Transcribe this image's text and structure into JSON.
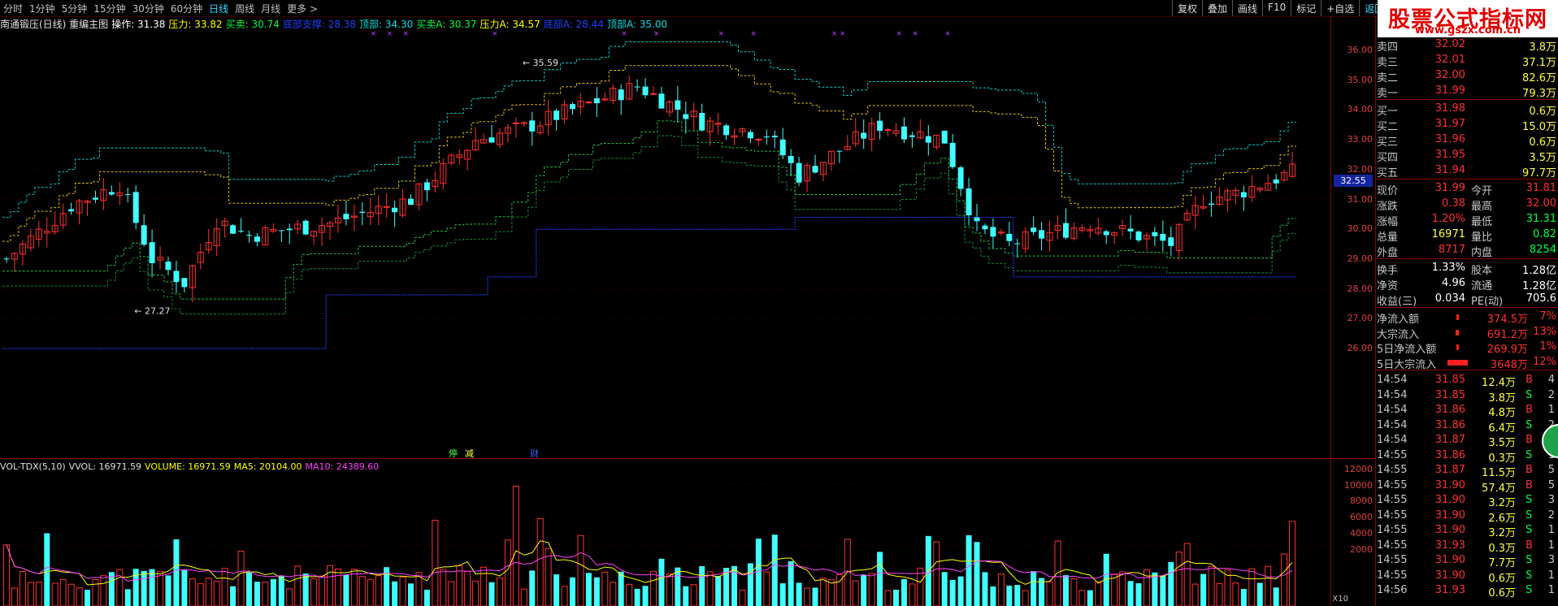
{
  "periods": [
    "分时",
    "1分钟",
    "5分钟",
    "15分钟",
    "30分钟",
    "60分钟",
    "日线",
    "周线",
    "月线",
    "更多 >"
  ],
  "active_period": "日线",
  "toolbar_buttons": [
    "复权",
    "叠加",
    "画线",
    "F10",
    "标记",
    "+自选",
    "返回"
  ],
  "logo": {
    "title": "股票公式指标网",
    "url": "www.gszx.com.cn"
  },
  "indicator_legend": [
    {
      "text": "南通锻压(日线) 重编主图",
      "color": "#e0e0e0"
    },
    {
      "text": "操作: 31.38",
      "color": "#ffffff"
    },
    {
      "text": "压力: 33.82",
      "color": "#ffff00"
    },
    {
      "text": "买卖: 30.74",
      "color": "#00ff40"
    },
    {
      "text": "底部支撑: 28.38",
      "color": "#2040ff"
    },
    {
      "text": "顶部: 34.30",
      "color": "#00e0e0"
    },
    {
      "text": "买卖A: 30.37",
      "color": "#00ff40"
    },
    {
      "text": "压力A: 34.57",
      "color": "#ffff00"
    },
    {
      "text": "底部A: 28.44",
      "color": "#2040ff"
    },
    {
      "text": "顶部A: 35.00",
      "color": "#00e0e0"
    }
  ],
  "price_axis": [
    "36.00",
    "35.00",
    "34.00",
    "33.00",
    "32.00",
    "31.00",
    "30.00",
    "29.00",
    "28.00",
    "27.00",
    "26.00"
  ],
  "current_price_tag": "32.55",
  "chart_annotations": {
    "high": "35.59",
    "low": "27.27"
  },
  "chart_flags": [
    {
      "text": "停",
      "color": "#40ff40"
    },
    {
      "text": "减",
      "color": "#ffff40"
    },
    {
      "text": "财",
      "color": "#4060ff"
    }
  ],
  "volume_legend": [
    {
      "text": "VOL-TDX(5,10)",
      "color": "#e0e0e0"
    },
    {
      "text": "VVOL: 16971.59",
      "color": "#e0e0e0"
    },
    {
      "text": "VOLUME: 16971.59",
      "color": "#ffff00"
    },
    {
      "text": "MA5: 20104.00",
      "color": "#ffff00"
    },
    {
      "text": "MA10: 24389.60",
      "color": "#ff40ff"
    }
  ],
  "volume_axis": [
    "12000",
    "10000",
    "8000",
    "6000",
    "4000",
    "2000"
  ],
  "volume_unit": "X10",
  "order_book": {
    "sells": [
      {
        "label": "卖四",
        "price": "32.02",
        "vol": "3.8万"
      },
      {
        "label": "卖三",
        "price": "32.01",
        "vol": "37.1万"
      },
      {
        "label": "卖二",
        "price": "32.00",
        "vol": "82.6万"
      },
      {
        "label": "卖一",
        "price": "31.99",
        "vol": "79.3万"
      }
    ],
    "buys": [
      {
        "label": "买一",
        "price": "31.98",
        "vol": "0.6万"
      },
      {
        "label": "买二",
        "price": "31.97",
        "vol": "15.0万"
      },
      {
        "label": "买三",
        "price": "31.96",
        "vol": "0.6万"
      },
      {
        "label": "买四",
        "price": "31.95",
        "vol": "3.5万"
      },
      {
        "label": "买五",
        "price": "31.94",
        "vol": "97.7万"
      }
    ]
  },
  "quote": [
    {
      "l1": "现价",
      "v1": "31.99",
      "c1": "#ff3030",
      "l2": "今开",
      "v2": "31.81",
      "c2": "#ff3030"
    },
    {
      "l1": "涨跌",
      "v1": "0.38",
      "c1": "#ff3030",
      "l2": "最高",
      "v2": "32.00",
      "c2": "#ff3030"
    },
    {
      "l1": "涨幅",
      "v1": "1.20%",
      "c1": "#ff3030",
      "l2": "最低",
      "v2": "31.31",
      "c2": "#00ff40"
    },
    {
      "l1": "总量",
      "v1": "16971",
      "c1": "#ffff40",
      "l2": "量比",
      "v2": "0.82",
      "c2": "#00ff40"
    },
    {
      "l1": "外盘",
      "v1": "8717",
      "c1": "#ff3030",
      "l2": "内盘",
      "v2": "8254",
      "c2": "#00ff40"
    }
  ],
  "fundamentals": [
    {
      "l1": "换手",
      "v1": "1.33%",
      "l2": "股本",
      "v2": "1.28亿"
    },
    {
      "l1": "净资",
      "v1": "4.96",
      "l2": "流通",
      "v2": "1.28亿"
    },
    {
      "l1": "收益(三)",
      "v1": "0.034",
      "l2": "PE(动)",
      "v2": "705.6"
    }
  ],
  "fund_flow": [
    {
      "label": "净流入额",
      "value": "374.5万",
      "pct": "7%",
      "bar": 0.04
    },
    {
      "label": "大宗流入",
      "value": "691.2万",
      "pct": "13%",
      "bar": 0.08
    },
    {
      "label": "5日净流入额",
      "value": "269.9万",
      "pct": "1%",
      "bar": 0.03
    },
    {
      "label": "5日大宗流入",
      "value": "3648万",
      "pct": "12%",
      "bar": 0.5
    }
  ],
  "ticks": [
    {
      "time": "14:54",
      "price": "31.85",
      "vol": "12.4万",
      "side": "B",
      "n": "4"
    },
    {
      "time": "14:54",
      "price": "31.85",
      "vol": "3.8万",
      "side": "S",
      "n": "2"
    },
    {
      "time": "14:54",
      "price": "31.86",
      "vol": "4.8万",
      "side": "B",
      "n": "1"
    },
    {
      "time": "14:54",
      "price": "31.86",
      "vol": "6.4万",
      "side": "S",
      "n": "2"
    },
    {
      "time": "14:54",
      "price": "31.87",
      "vol": "3.5万",
      "side": "B",
      "n": "1"
    },
    {
      "time": "14:55",
      "price": "31.86",
      "vol": "0.3万",
      "side": "S",
      "n": "1"
    },
    {
      "time": "14:55",
      "price": "31.87",
      "vol": "11.5万",
      "side": "B",
      "n": "5"
    },
    {
      "time": "14:55",
      "price": "31.90",
      "vol": "57.4万",
      "side": "B",
      "n": "5"
    },
    {
      "time": "14:55",
      "price": "31.90",
      "vol": "3.2万",
      "side": "S",
      "n": "3"
    },
    {
      "time": "14:55",
      "price": "31.90",
      "vol": "2.6万",
      "side": "S",
      "n": "2"
    },
    {
      "time": "14:55",
      "price": "31.90",
      "vol": "3.2万",
      "side": "S",
      "n": "1"
    },
    {
      "time": "14:55",
      "price": "31.93",
      "vol": "0.3万",
      "side": "B",
      "n": "1"
    },
    {
      "time": "14:55",
      "price": "31.90",
      "vol": "7.7万",
      "side": "S",
      "n": "3"
    },
    {
      "time": "14:55",
      "price": "31.90",
      "vol": "0.6万",
      "side": "S",
      "n": "1"
    },
    {
      "time": "14:56",
      "price": "31.93",
      "vol": "0.6万",
      "side": "S",
      "n": "1"
    }
  ],
  "colors": {
    "up": "#ff3030",
    "down": "#40ffff",
    "axis": "#8a0000",
    "support": "#2040ff"
  }
}
